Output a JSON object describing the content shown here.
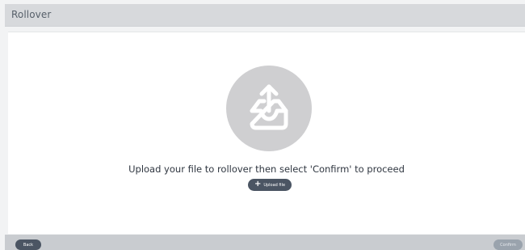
{
  "window": {
    "title": "Rollover"
  },
  "main": {
    "upload_icon": "upload-tray-icon",
    "message": "Upload your file to rollover then select 'Confirm' to proceed",
    "upload_button": {
      "icon": "plus-icon",
      "label": "Upload file"
    }
  },
  "footer": {
    "back_label": "Back",
    "confirm_label": "Confirm"
  },
  "colors": {
    "primary_button": "#4b5563",
    "disabled_button": "#9aa3ad",
    "circle": "#cfcfd1"
  }
}
